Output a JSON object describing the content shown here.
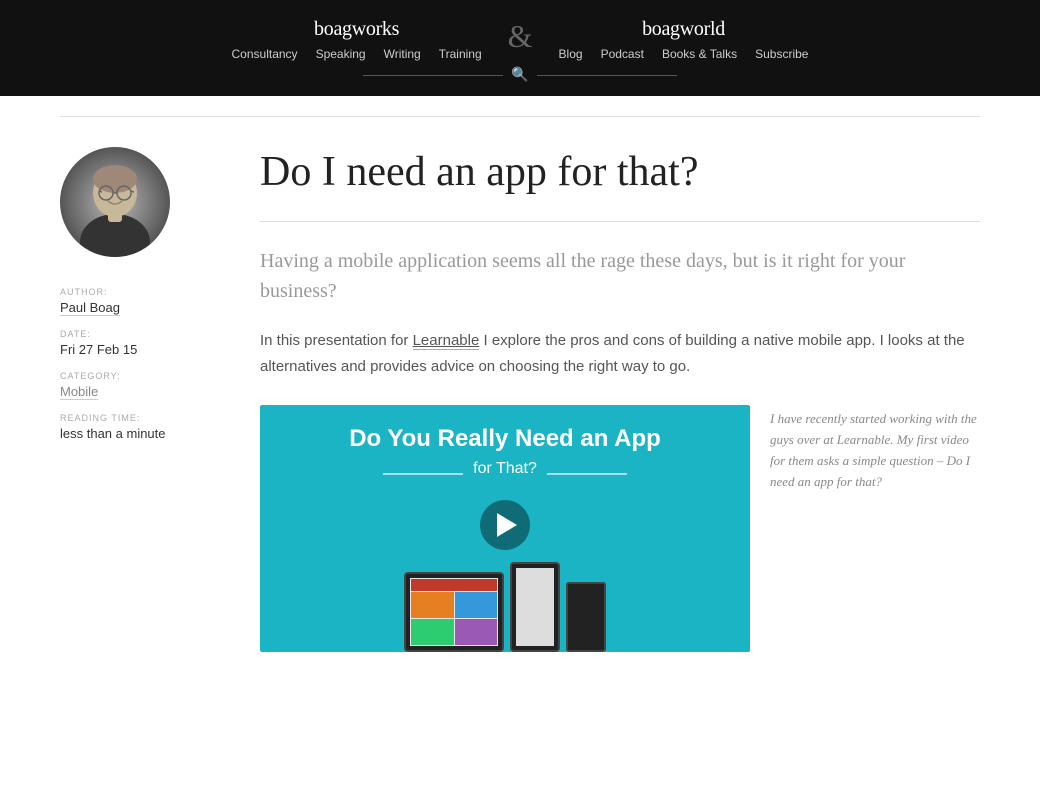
{
  "header": {
    "boagworks_logo": "boagworks",
    "ampersand": "&",
    "boagworld_logo": "boagworld",
    "boagworks_nav": [
      {
        "label": "Consultancy",
        "href": "#"
      },
      {
        "label": "Speaking",
        "href": "#"
      },
      {
        "label": "Writing",
        "href": "#"
      },
      {
        "label": "Training",
        "href": "#"
      }
    ],
    "boagworld_nav": [
      {
        "label": "Blog",
        "href": "#"
      },
      {
        "label": "Podcast",
        "href": "#"
      },
      {
        "label": "Books & Talks",
        "href": "#"
      },
      {
        "label": "Subscribe",
        "href": "#"
      }
    ]
  },
  "article": {
    "title": "Do I need an app for that?",
    "intro": "Having a mobile application seems all the rage these days, but is it right for your business?",
    "body": "In this presentation for Learnable I explore the pros and cons of building a native mobile app. I looks at the alternatives and provides advice on choosing the right way to go.",
    "learnable_link_text": "Learnable",
    "video_title": "Do You Really Need an App",
    "video_sub": "for That?",
    "video_caption": "I have recently started working with the guys over at Learnable. My first video for them asks a simple question – Do I need an app for that?"
  },
  "meta": {
    "author_label": "AUTHOR:",
    "author_name": "Paul Boag",
    "date_label": "DATE:",
    "date_value": "Fri 27 Feb 15",
    "category_label": "CATEGORY:",
    "category_value": "Mobile",
    "reading_label": "READING TIME:",
    "reading_value": "less than a minute"
  }
}
